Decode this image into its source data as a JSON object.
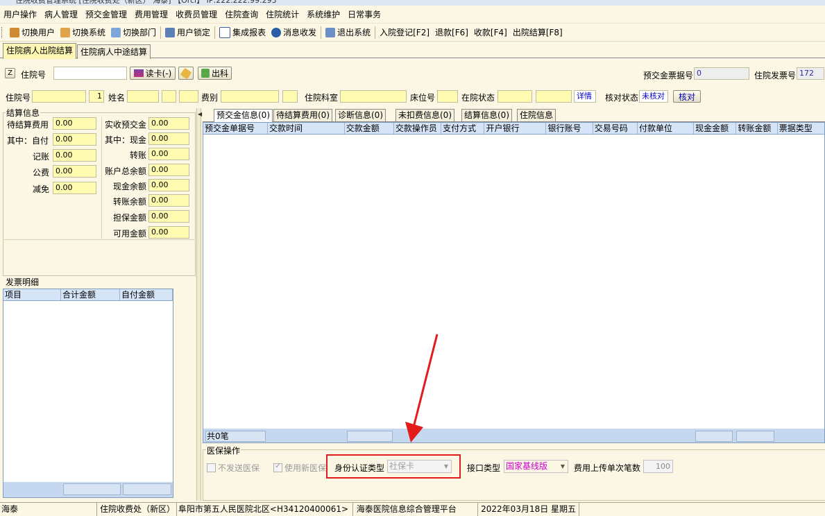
{
  "window": {
    "title": "住院收费管理系统 [住院收费处（新区） 海泰]  【Orcl】 IP:222.222.99.293"
  },
  "menu": [
    "用户操作",
    "病人管理",
    "预交金管理",
    "费用管理",
    "收费员管理",
    "住院查询",
    "住院统计",
    "系统维护",
    "日常事务"
  ],
  "toolbar": {
    "switch_user": "切换用户",
    "switch_system": "切换系统",
    "switch_dept": "切换部门",
    "lock_user": "用户锁定",
    "report": "集成报表",
    "message": "消息收发",
    "exit": "退出系统",
    "admission": "入院登记[F2]",
    "refund": "退款[F6]",
    "charge": "收款[F4]",
    "discharge": "出院结算[F8]"
  },
  "top_tabs": [
    "住院病人出院结算",
    "住院病人中途结算"
  ],
  "search": {
    "z_label": "Z",
    "hosp_no_label": "住院号",
    "hosp_no_value": "",
    "read_card": "读卡(-)",
    "discharge_btn": "出科",
    "deposit_receipt_label": "预交金票据号",
    "deposit_receipt_value": "0",
    "invoice_label": "住院发票号",
    "invoice_value": "172"
  },
  "patient": {
    "hosp_no_label": "住院号",
    "seq_value": "1",
    "name_label": "姓名",
    "fee_type_label": "费别",
    "dept_label": "住院科室",
    "bed_label": "床位号",
    "status_label": "在院状态",
    "detail_link": "详情",
    "check_status_label": "核对状态",
    "check_status_value": "未核对",
    "check_button": "核对"
  },
  "settle": {
    "title": "结算信息",
    "left": [
      {
        "label": "待结算费用",
        "value": "0.00"
      },
      {
        "label": "其中：自付",
        "value": "0.00"
      },
      {
        "label": "记账",
        "value": "0.00"
      },
      {
        "label": "公费",
        "value": "0.00"
      },
      {
        "label": "减免",
        "value": "0.00"
      }
    ],
    "right": [
      {
        "label": "实收预交金",
        "value": "0.00"
      },
      {
        "label": "其中：现金",
        "value": "0.00"
      },
      {
        "label": "转账",
        "value": "0.00"
      },
      {
        "label": "账户总余额",
        "value": "0.00"
      },
      {
        "label": "现金余额",
        "value": "0.00"
      },
      {
        "label": "转账余额",
        "value": "0.00"
      },
      {
        "label": "担保金额",
        "value": "0.00"
      },
      {
        "label": "可用金额",
        "value": "0.00"
      }
    ]
  },
  "invoice_detail": {
    "title": "发票明细",
    "columns": [
      "项目",
      "合计金额",
      "自付金额"
    ]
  },
  "inner_tabs": [
    "预交金信息(0)",
    "待结算费用(0)",
    "诊断信息(0)",
    "未扣费信息(0)",
    "结算信息(0)",
    "住院信息"
  ],
  "grid": {
    "columns": [
      "预交金单据号",
      "交款时间",
      "交款金额",
      "交款操作员",
      "支付方式",
      "开户银行",
      "银行账号",
      "交易号码",
      "付款单位",
      "现金金额",
      "转账金额",
      "票据类型"
    ],
    "footer_count": "共0笔"
  },
  "insurance": {
    "title": "医保操作",
    "no_send_label": "不发送医保",
    "use_new_label": "使用新医保",
    "id_type_label": "身份认证类型",
    "id_type_value": "社保卡",
    "interface_label": "接口类型",
    "interface_value": "国家基线版",
    "upload_label": "费用上传单次笔数",
    "upload_value": "100"
  },
  "statusbar": [
    "海泰",
    "住院收费处（新区）",
    "阜阳市第五人民医院北区<H34120400061>",
    "海泰医院信息综合管理平台",
    "2022年03月18日  星期五",
    ""
  ],
  "colors": {
    "field_yellow": "#fffbb0",
    "grid_header": "#d6e4f8",
    "highlight_red": "#e21b1b",
    "interface_magenta": "#cc00cc",
    "link_blue": "#0000cc"
  }
}
